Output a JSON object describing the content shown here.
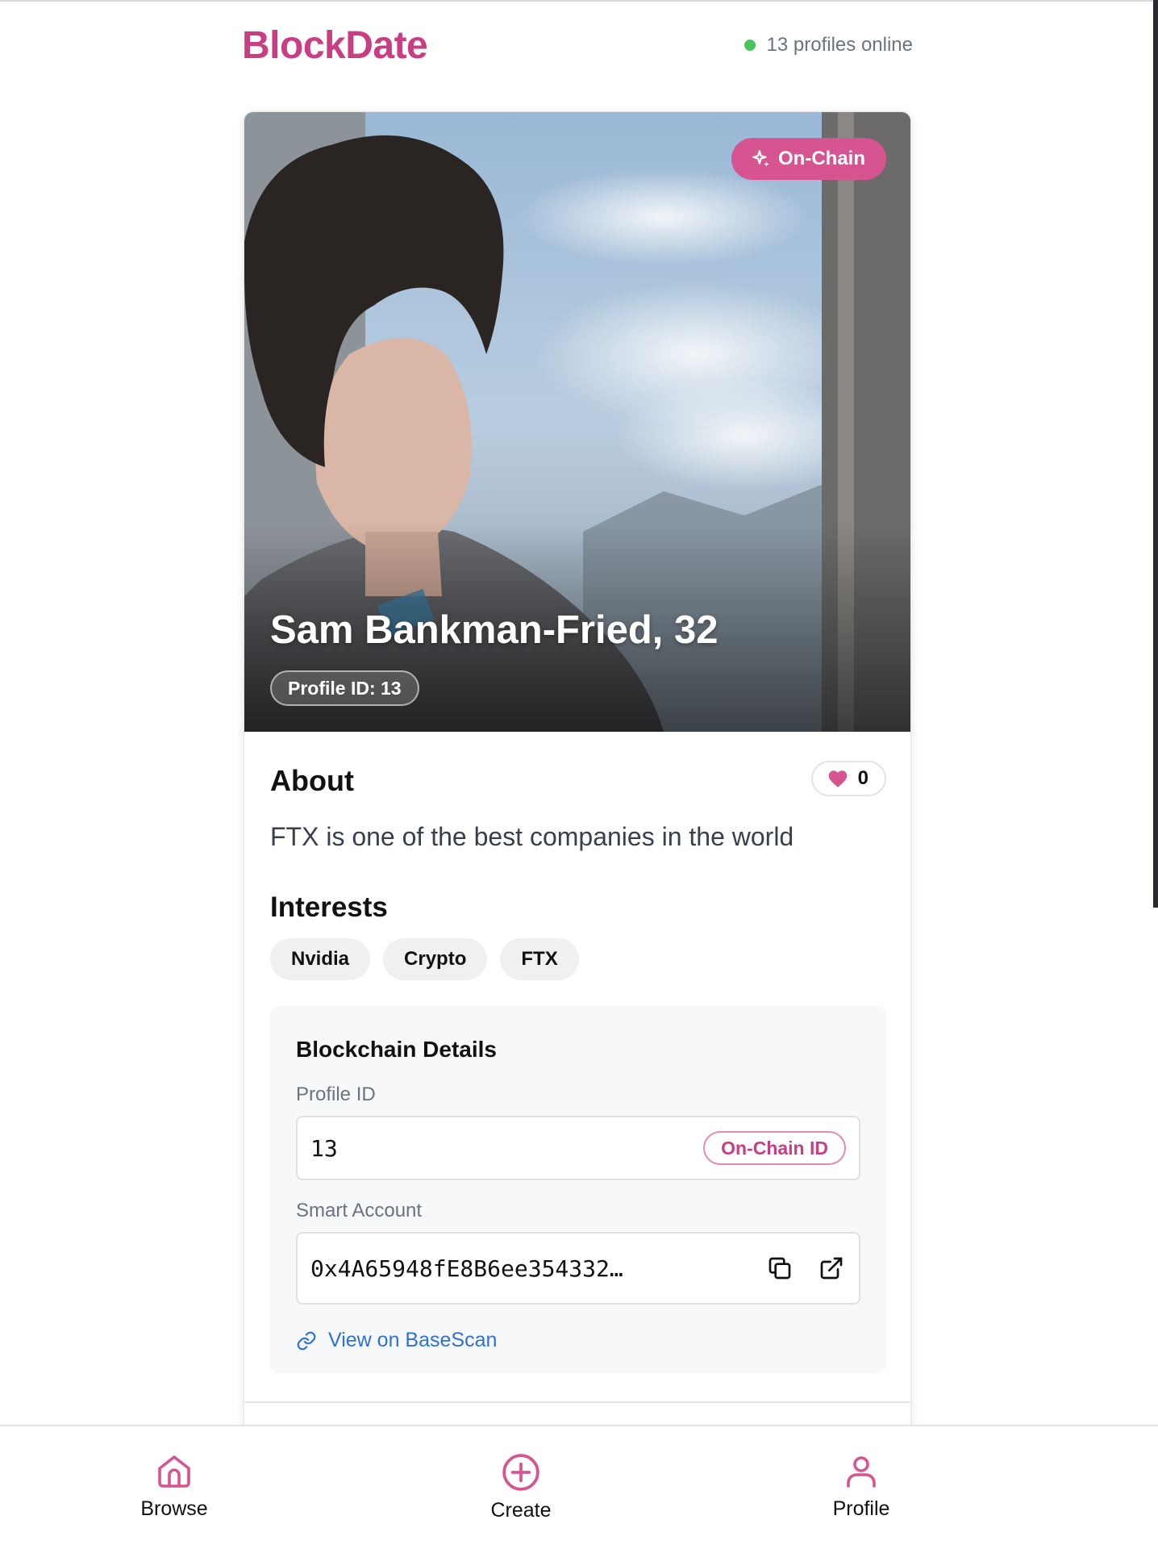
{
  "app": {
    "brand": "BlockDate",
    "online_text": "13 profiles online",
    "colors": {
      "accent": "#c93d82",
      "online": "#4cc35a",
      "link": "#2f6fdc"
    }
  },
  "profile": {
    "badge": "On-Chain",
    "name_age": "Sam Bankman-Fried, 32",
    "id_pill": "Profile ID: 13",
    "photo_icon": "portrait-photo",
    "about_title": "About",
    "likes": "0",
    "bio": "FTX is one of the best companies in the world",
    "interests_title": "Interests",
    "interests": [
      "Nvidia",
      "Crypto",
      "FTX"
    ]
  },
  "blockchain": {
    "title": "Blockchain Details",
    "profile_id_label": "Profile ID",
    "profile_id_value": "13",
    "profile_id_chip": "On-Chain ID",
    "smart_account_label": "Smart Account",
    "smart_account_value": "0x4A65948fE8B6ee354332…",
    "basescan_link": "View on BaseScan"
  },
  "nav": {
    "items": [
      {
        "label": "Browse",
        "icon": "home-icon"
      },
      {
        "label": "Create",
        "icon": "plus-circle-icon"
      },
      {
        "label": "Profile",
        "icon": "user-icon"
      }
    ]
  }
}
